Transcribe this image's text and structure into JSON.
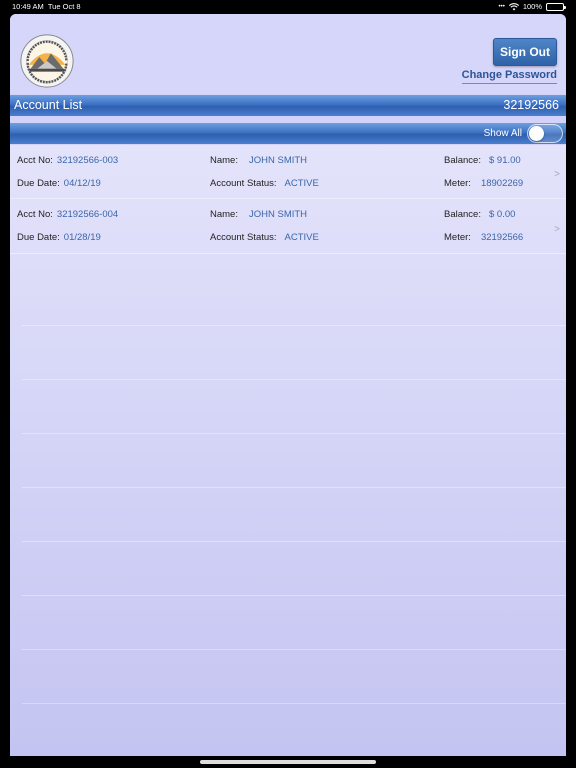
{
  "status": {
    "time": "10:49 AM",
    "date": "Tue Oct 8",
    "battery": "100%"
  },
  "header": {
    "sign_out": "Sign Out",
    "change_password": "Change Password"
  },
  "account_bar": {
    "title": "Account List",
    "number": "32192566"
  },
  "show_all": {
    "label": "Show All",
    "on": false
  },
  "labels": {
    "acct_no": "Acct No:",
    "due_date": "Due Date:",
    "name": "Name:",
    "account_status": "Account Status:",
    "balance": "Balance:",
    "meter": "Meter:"
  },
  "accounts": [
    {
      "acct_no": "32192566-003",
      "due_date": "04/12/19",
      "name": "JOHN SMITH",
      "status": "ACTIVE",
      "balance": "$ 91.00",
      "meter": "18902269"
    },
    {
      "acct_no": "32192566-004",
      "due_date": "01/28/19",
      "name": "JOHN SMITH",
      "status": "ACTIVE",
      "balance": "$ 0.00",
      "meter": "32192566"
    }
  ],
  "chevron": ">"
}
